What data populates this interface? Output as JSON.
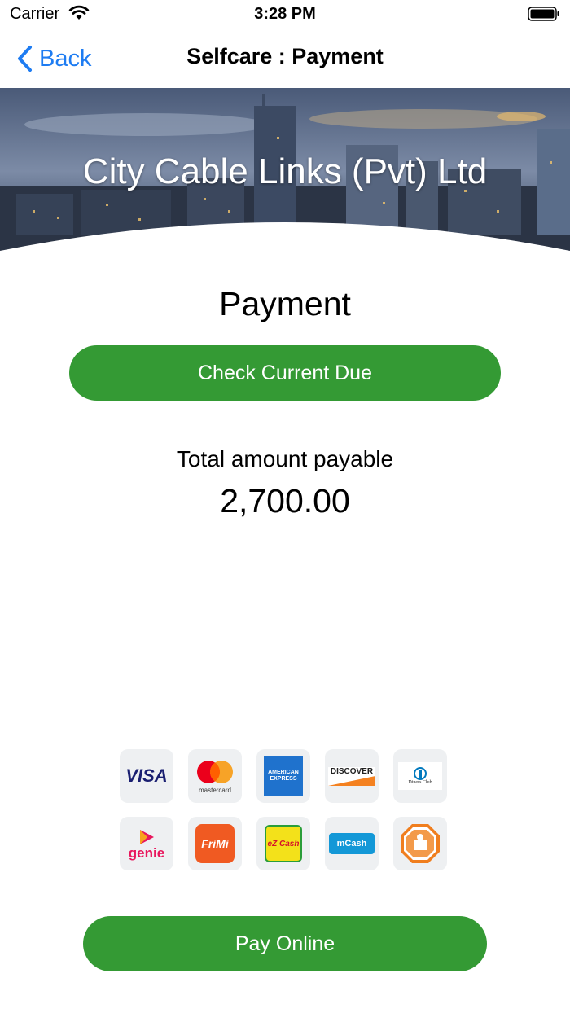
{
  "status_bar": {
    "carrier": "Carrier",
    "time": "3:28 PM"
  },
  "nav": {
    "back_label": "Back",
    "title": "Selfcare : Payment"
  },
  "banner": {
    "title": "City Cable Links (Pvt) Ltd"
  },
  "page": {
    "heading": "Payment",
    "check_due_label": "Check Current Due",
    "total_label": "Total amount payable",
    "total_amount": "2,700.00",
    "pay_online_label": "Pay Online"
  },
  "payment_methods": [
    {
      "name": "visa",
      "text": "VISA"
    },
    {
      "name": "mastercard",
      "text": "mastercard"
    },
    {
      "name": "american-express",
      "text": "AMERICAN EXPRESS"
    },
    {
      "name": "discover",
      "text": "DISCOVER"
    },
    {
      "name": "diners-club",
      "text": "Diners Club"
    },
    {
      "name": "genie",
      "text": "genie"
    },
    {
      "name": "frimi",
      "text": "FriMi"
    },
    {
      "name": "ezcash",
      "text": "eZ Cash"
    },
    {
      "name": "mcash",
      "text": "mCash"
    },
    {
      "name": "octagon-logo",
      "text": ""
    }
  ],
  "colors": {
    "accent_green": "#349a34",
    "ios_blue": "#1e7cf2"
  }
}
